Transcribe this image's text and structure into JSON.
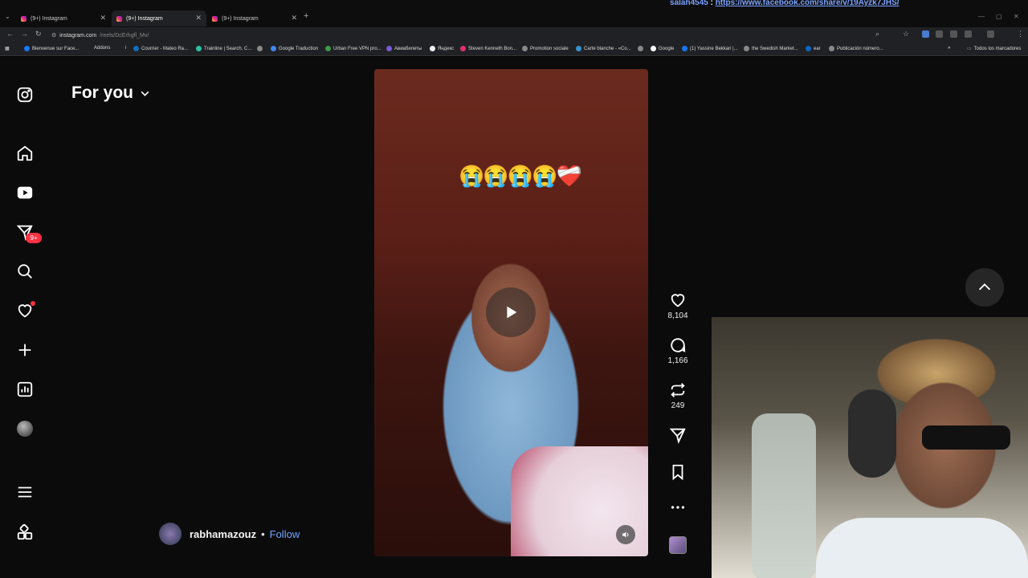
{
  "browser": {
    "tabs": [
      {
        "title": "(9+) Instagram",
        "active": false
      },
      {
        "title": "(9+) Instagram",
        "active": true
      },
      {
        "title": "(9+) Instagram",
        "active": false
      }
    ],
    "overlay_user": "salah4545",
    "overlay_sep": ":",
    "overlay_url": "https://www.facebook.com/share/v/19Ayzk7JHS/",
    "url_host": "instagram.com",
    "url_path": "/reels/DcErhgfl_Mv/",
    "bookmarks": [
      "Bienvenue sur Face...",
      "Addons",
      "Courrier - Mateo Ra...",
      "Trainline | Search, C...",
      "Google Traduction",
      "Urban Free VPN pro...",
      "Авиабилеты",
      "Яндекс",
      "Steven Kenneth Bon...",
      "Promotion sociale",
      "Carte blanche - «Co...",
      "Google",
      "(1) Yassine Bekkari |...",
      "the Swedish Market...",
      "ear",
      "Publicación número..."
    ],
    "all_bookmarks": "Todos los marcadores"
  },
  "sidebar": {
    "notifications_badge": "9+"
  },
  "feed": {
    "title": "For you"
  },
  "reel": {
    "caption_emojis": "😭😭😭😭❤️‍🩹",
    "creator": "rabhamazouz",
    "follow_label": "Follow",
    "dot": "•",
    "likes": "8,104",
    "comments": "1,166",
    "reposts": "249"
  },
  "colors": {
    "accent_follow": "#70a6ff",
    "badge": "#ff3040",
    "background": "#0b0b0c"
  }
}
